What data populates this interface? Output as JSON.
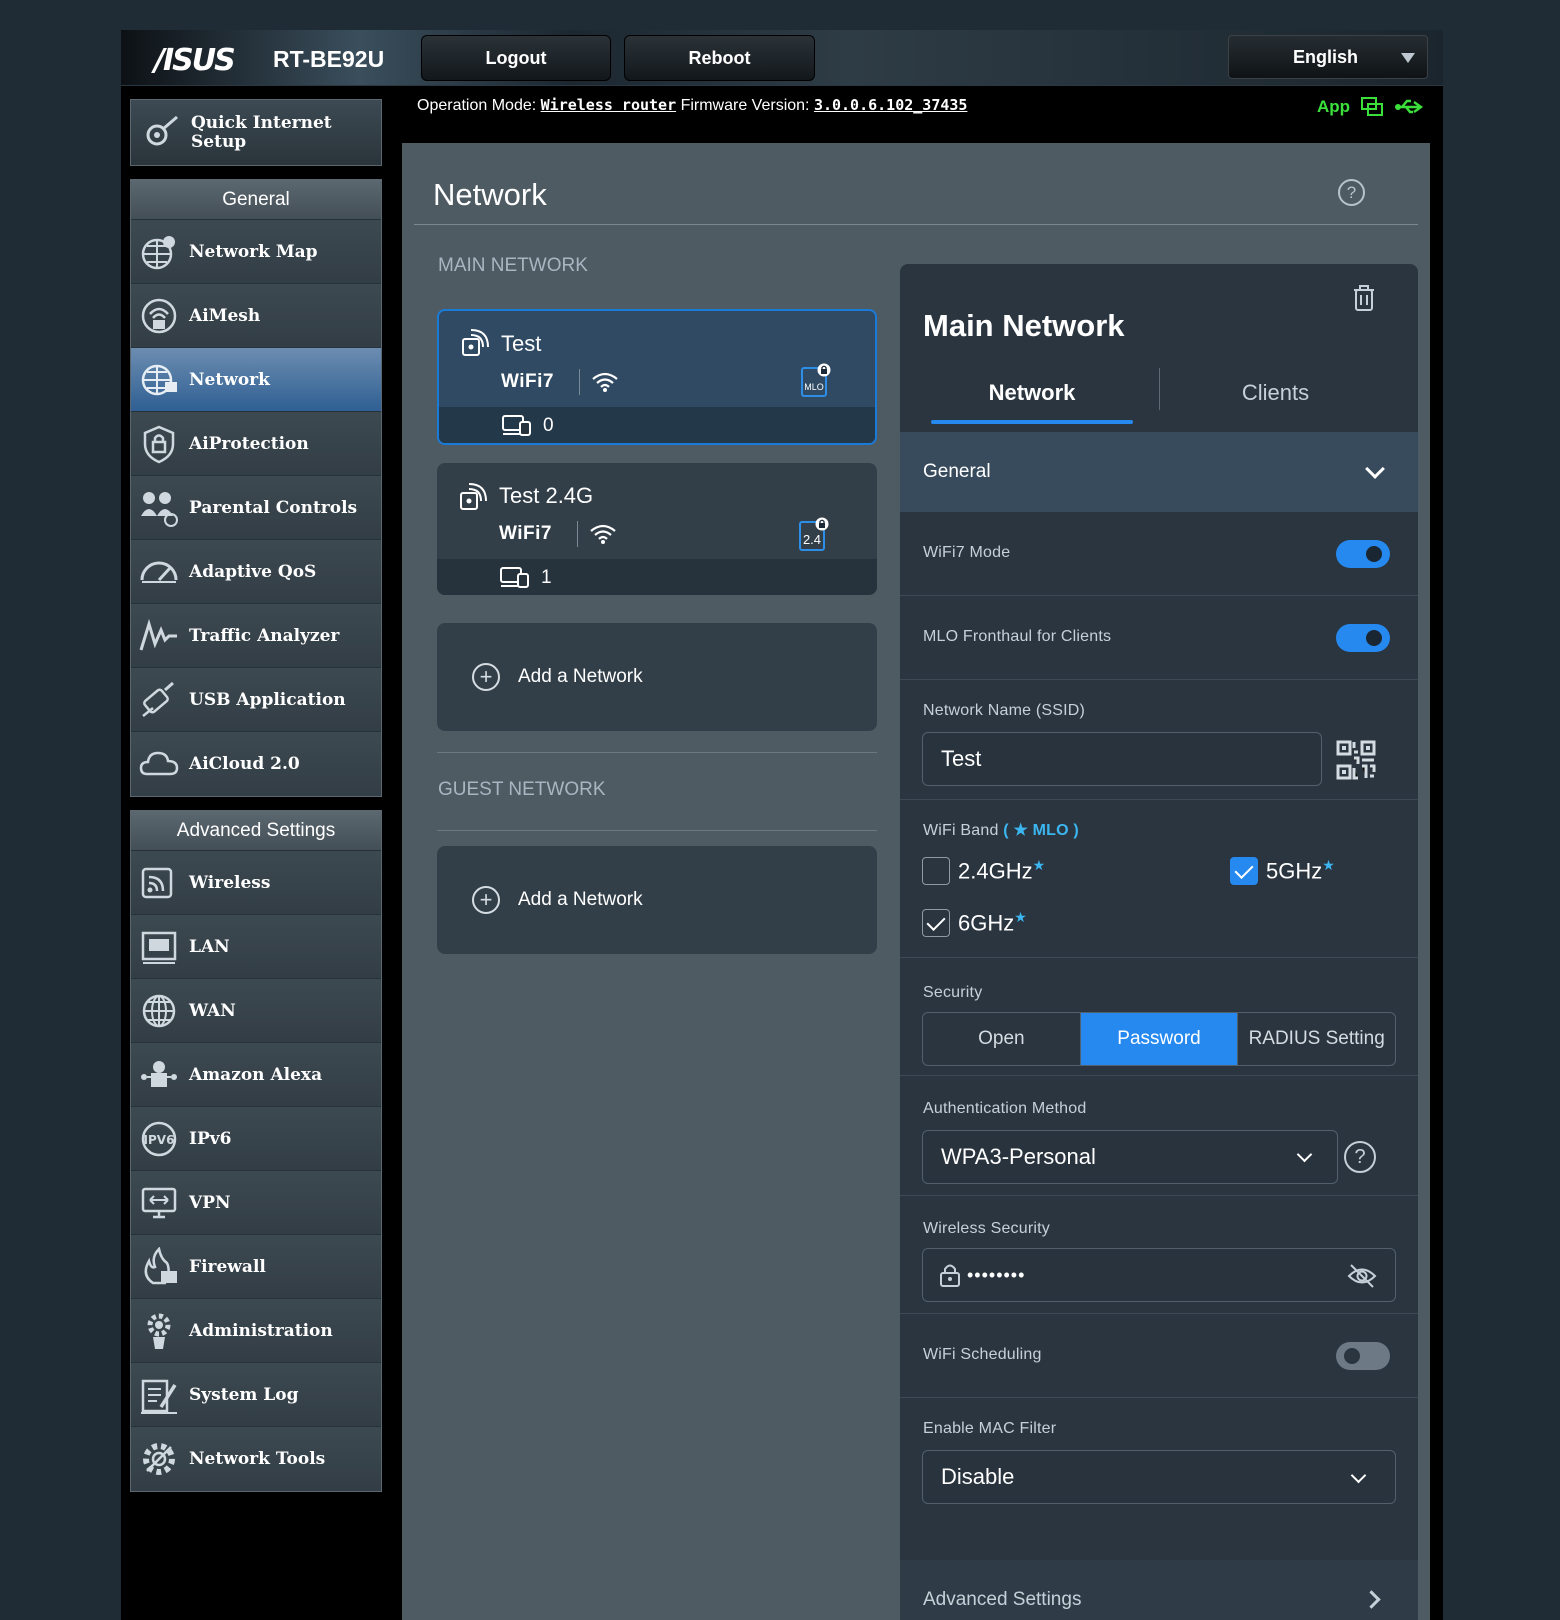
{
  "header": {
    "brand": "/ISUS",
    "model": "RT-BE92U",
    "logout_label": "Logout",
    "reboot_label": "Reboot",
    "language": "English"
  },
  "status_bar": {
    "operation_mode_label": "Operation Mode:",
    "operation_mode_value": "Wireless router",
    "firmware_label": "Firmware Version:",
    "firmware_value": "3.0.0.6.102_37435",
    "app_label": "App"
  },
  "sidebar": {
    "quick_setup": "Quick Internet Setup",
    "general_title": "General",
    "general_items": [
      {
        "label": "Network Map",
        "icon": "globe-pin-icon"
      },
      {
        "label": "AiMesh",
        "icon": "mesh-icon"
      },
      {
        "label": "Network",
        "icon": "globe-network-icon",
        "active": true
      },
      {
        "label": "AiProtection",
        "icon": "shield-lock-icon"
      },
      {
        "label": "Parental Controls",
        "icon": "family-icon"
      },
      {
        "label": "Adaptive QoS",
        "icon": "gauge-icon"
      },
      {
        "label": "Traffic Analyzer",
        "icon": "pulse-icon"
      },
      {
        "label": "USB Application",
        "icon": "usb-icon"
      },
      {
        "label": "AiCloud 2.0",
        "icon": "cloud-icon"
      }
    ],
    "advanced_title": "Advanced Settings",
    "advanced_items": [
      {
        "label": "Wireless",
        "icon": "wireless-icon"
      },
      {
        "label": "LAN",
        "icon": "lan-icon"
      },
      {
        "label": "WAN",
        "icon": "globe-icon"
      },
      {
        "label": "Amazon Alexa",
        "icon": "alexa-icon"
      },
      {
        "label": "IPv6",
        "icon": "ipv6-icon"
      },
      {
        "label": "VPN",
        "icon": "vpn-icon"
      },
      {
        "label": "Firewall",
        "icon": "firewall-icon"
      },
      {
        "label": "Administration",
        "icon": "admin-gear-icon"
      },
      {
        "label": "System Log",
        "icon": "log-icon"
      },
      {
        "label": "Network Tools",
        "icon": "tools-gear-icon"
      }
    ]
  },
  "main": {
    "title": "Network",
    "main_network_label": "MAIN NETWORK",
    "networks": [
      {
        "name": "Test",
        "wifi_label": "WiFi7",
        "badge": "MLO",
        "clients": "0"
      },
      {
        "name": "Test 2.4G",
        "wifi_label": "WiFi7",
        "badge": "2.4",
        "clients": "1"
      }
    ],
    "add_network_label": "Add a Network",
    "guest_network_label": "GUEST NETWORK",
    "guest_add_label": "Add a Network"
  },
  "panel": {
    "title": "Main Network",
    "tab_network": "Network",
    "tab_clients": "Clients",
    "general_label": "General",
    "wifi7_mode_label": "WiFi7 Mode",
    "wifi7_mode_on": true,
    "mlo_label": "MLO Fronthaul for Clients",
    "mlo_on": true,
    "ssid_label": "Network Name (SSID)",
    "ssid_value": "Test",
    "band_label": "WiFi Band",
    "band_mlo_note": "( ★ MLO )",
    "bands": [
      {
        "label": "2.4GHz",
        "checked": false
      },
      {
        "label": "5GHz",
        "checked": true
      },
      {
        "label": "6GHz",
        "checked": true
      }
    ],
    "security_label": "Security",
    "security_options": [
      "Open",
      "Password",
      "RADIUS Setting"
    ],
    "security_selected": "Password",
    "auth_label": "Authentication Method",
    "auth_value": "WPA3-Personal",
    "wsec_label": "Wireless Security",
    "wsec_value": "••••••••",
    "sched_label": "WiFi Scheduling",
    "sched_on": false,
    "mac_label": "Enable MAC Filter",
    "mac_value": "Disable",
    "advanced_label": "Advanced Settings"
  }
}
